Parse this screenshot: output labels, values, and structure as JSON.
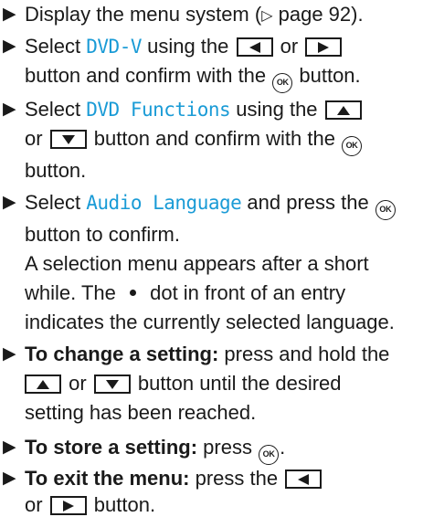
{
  "steps": [
    {
      "text_1": "Display the menu system (",
      "page_ref_arrow": "▷",
      "text_2": " page 92)."
    },
    {
      "text_1": "Select ",
      "term": "DVD-V",
      "text_2": " using the ",
      "text_3": " or ",
      "text_4": "button and confirm with the ",
      "text_5": " button."
    },
    {
      "text_1": "Select ",
      "term": "DVD Functions",
      "text_2": " using the ",
      "text_3": "or ",
      "text_4": " button and confirm with the ",
      "text_5": "button."
    },
    {
      "text_1": "Select ",
      "term": "Audio Language",
      "text_2": " and press the ",
      "text_3": "button to confirm.",
      "text_4": "A selection menu appears after a short",
      "text_5": "while. The ",
      "text_6": " dot in front of an entry",
      "text_7": "indicates the currently selected language."
    },
    {
      "bold": "To change a setting:",
      "text_1": " press and hold the",
      "text_2": " or ",
      "text_3": " button until the desired",
      "text_4": "setting has been reached."
    },
    {
      "bold": "To store a setting:",
      "text_1": " press ",
      "text_2": "."
    },
    {
      "bold": "To exit the menu:",
      "text_1": " press the ",
      "text_2": "or ",
      "text_3": " button."
    }
  ],
  "ok_label": "OK",
  "icons": {
    "bullet": "triangle-right-bullet-icon",
    "left_key": "left-arrow-key-icon",
    "right_key": "right-arrow-key-icon",
    "up_key": "up-arrow-key-icon",
    "down_key": "down-arrow-key-icon",
    "ok_button": "ok-button-icon",
    "selection_dot": "selection-dot-icon"
  },
  "colors": {
    "term": "#1a9bd6",
    "text": "#1a1a1a"
  }
}
